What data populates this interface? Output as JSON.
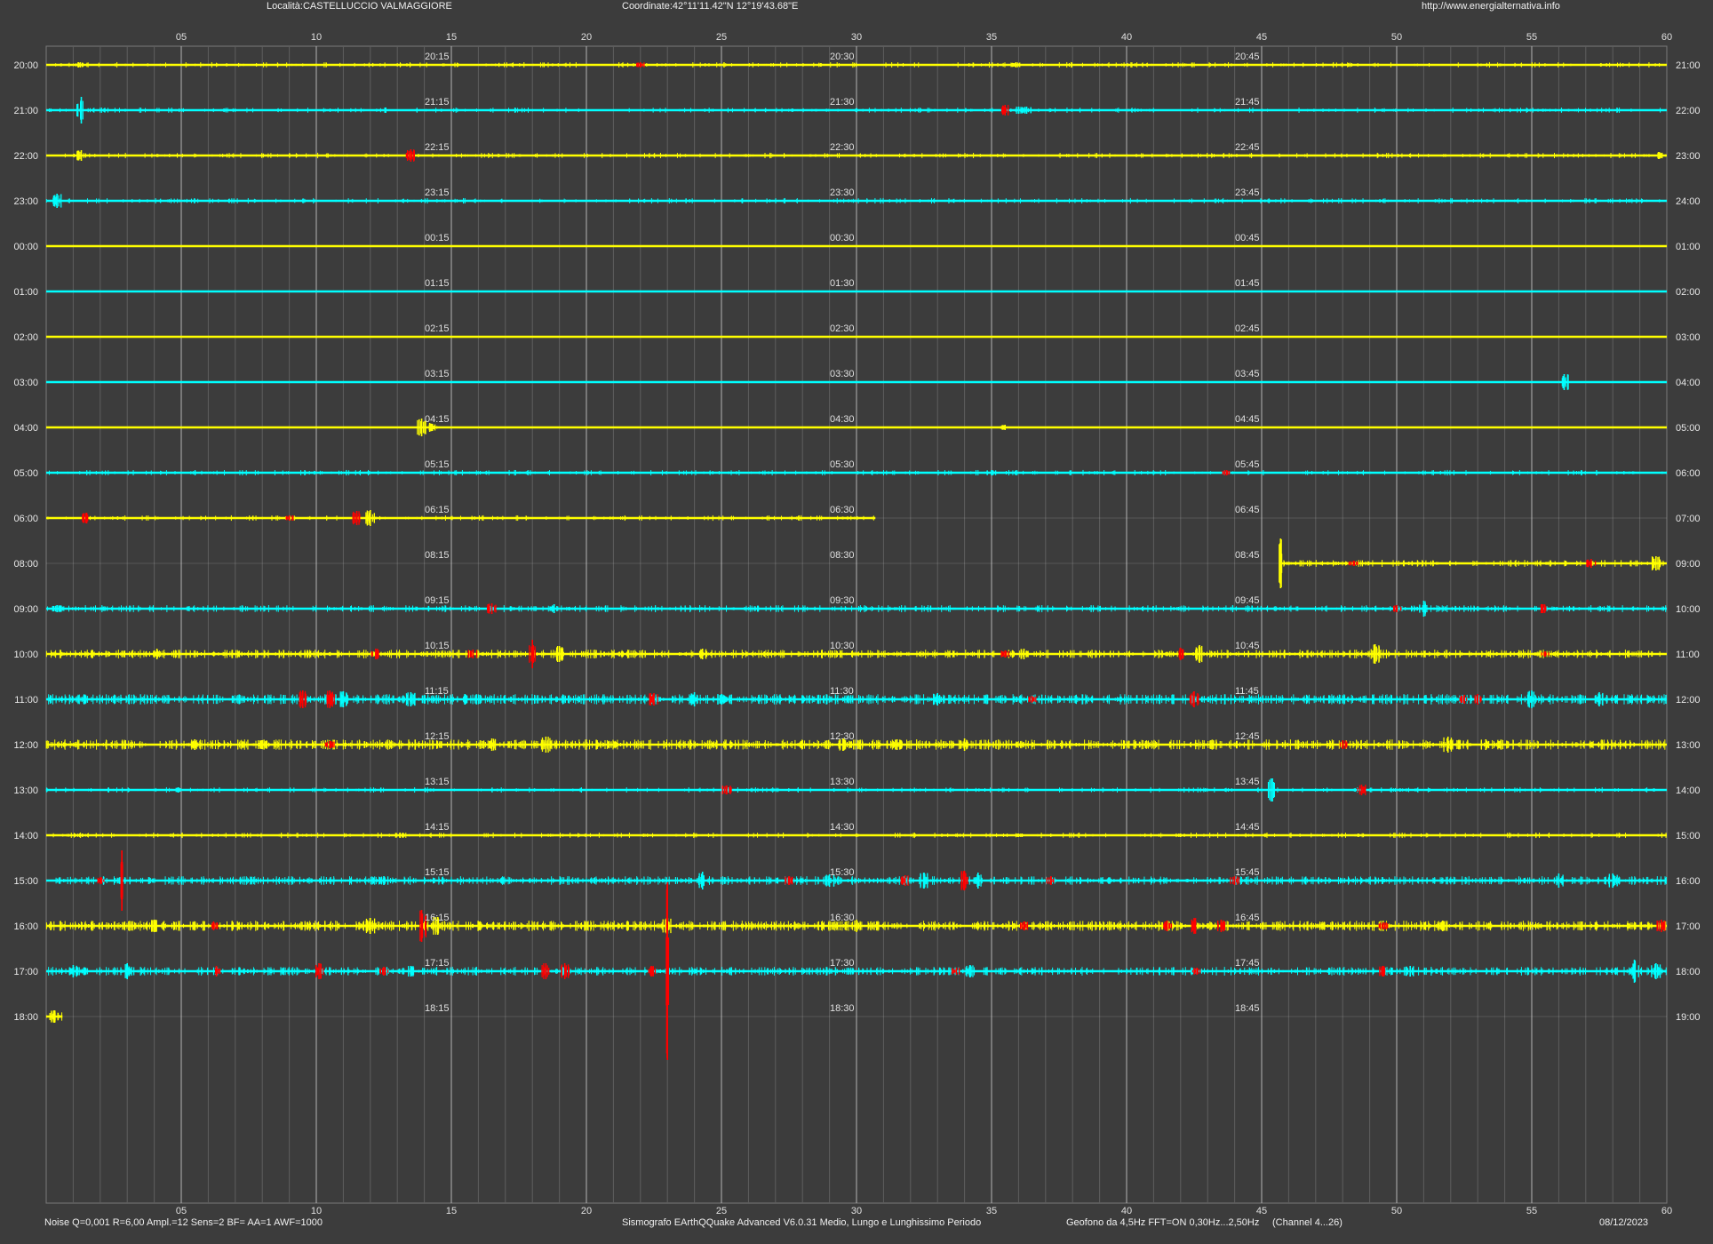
{
  "header": {
    "location": "Località:CASTELLUCCIO VALMAGGIORE",
    "coordinates": "Coordinate:42°11'11.42\"N  12°19'43.68\"E",
    "website": "http://www.energialternativa.info"
  },
  "footer": {
    "noise_params": "Noise Q=0,001 R=6,00 Ampl.=12 Sens=2 BF= AA=1 AWF=1000",
    "software": "Sismografo  EArthQQuake Advanced V6.0.31  Medio, Lungo e Lunghissimo Periodo",
    "geofono": "Geofono da 4,5Hz FFT=ON 0,30Hz...2,50Hz",
    "channel": "(Channel 4...26)",
    "date": "08/12/2023"
  },
  "colors": {
    "background": "#3c3c3c",
    "grid": "#7a7a7a",
    "trace_yellow": "#ffff00",
    "trace_cyan": "#00ffff",
    "event_red": "#ff0000"
  },
  "chart_data": {
    "type": "line",
    "xlabel": "",
    "ylabel": "",
    "xlim": [
      0,
      60
    ],
    "x_ticks": [
      "05",
      "10",
      "15",
      "20",
      "25",
      "30",
      "35",
      "40",
      "45",
      "50",
      "55",
      "60"
    ],
    "slot_labels_offsets": [
      "15",
      "30",
      "45"
    ],
    "rows": [
      {
        "left": "20:00",
        "right": "21:00",
        "slots": [
          "20:15",
          "20:30",
          "20:45"
        ],
        "color": "yellow",
        "end": 60,
        "activity": 1,
        "spikes": [
          {
            "x": 1.2,
            "amp": 3
          },
          {
            "x": 22.0,
            "amp": 3,
            "red": true
          },
          {
            "x": 35.9,
            "amp": 3
          }
        ]
      },
      {
        "left": "21:00",
        "right": "22:00",
        "slots": [
          "21:15",
          "21:30",
          "21:45"
        ],
        "color": "cyan",
        "end": 60,
        "activity": 1,
        "spikes": [
          {
            "x": 1.3,
            "amp": 15
          },
          {
            "x": 35.5,
            "amp": 6,
            "red": true
          },
          {
            "x": 36.0,
            "amp": 4
          },
          {
            "x": 36.3,
            "amp": 4
          }
        ]
      },
      {
        "left": "22:00",
        "right": "23:00",
        "slots": [
          "22:15",
          "22:30",
          "22:45"
        ],
        "color": "yellow",
        "end": 60,
        "activity": 1,
        "spikes": [
          {
            "x": 1.3,
            "amp": 6
          },
          {
            "x": 13.5,
            "amp": 7,
            "red": true
          },
          {
            "x": 59.7,
            "amp": 4
          }
        ]
      },
      {
        "left": "23:00",
        "right": "24:00",
        "slots": [
          "23:15",
          "23:30",
          "23:45"
        ],
        "color": "cyan",
        "end": 60,
        "activity": 1,
        "spikes": [
          {
            "x": 0.4,
            "amp": 8
          }
        ]
      },
      {
        "left": "00:00",
        "right": "01:00",
        "slots": [
          "00:15",
          "00:30",
          "00:45"
        ],
        "color": "yellow",
        "end": 60,
        "activity": 0,
        "spikes": []
      },
      {
        "left": "01:00",
        "right": "02:00",
        "slots": [
          "01:15",
          "01:30",
          "01:45"
        ],
        "color": "cyan",
        "end": 60,
        "activity": 0,
        "spikes": []
      },
      {
        "left": "02:00",
        "right": "03:00",
        "slots": [
          "02:15",
          "02:30",
          "02:45"
        ],
        "color": "yellow",
        "end": 60,
        "activity": 0,
        "spikes": []
      },
      {
        "left": "03:00",
        "right": "04:00",
        "slots": [
          "03:15",
          "03:30",
          "03:45"
        ],
        "color": "cyan",
        "end": 60,
        "activity": 0,
        "spikes": [
          {
            "x": 56.2,
            "amp": 9
          }
        ]
      },
      {
        "left": "04:00",
        "right": "05:00",
        "slots": [
          "04:15",
          "04:30",
          "04:45"
        ],
        "color": "yellow",
        "end": 60,
        "activity": 0,
        "spikes": [
          {
            "x": 13.9,
            "amp": 10
          },
          {
            "x": 14.2,
            "amp": 5
          },
          {
            "x": 14.3,
            "amp": 4
          },
          {
            "x": 35.5,
            "amp": 3
          }
        ]
      },
      {
        "left": "05:00",
        "right": "06:00",
        "slots": [
          "05:15",
          "05:30",
          "05:45"
        ],
        "color": "cyan",
        "end": 60,
        "activity": 1,
        "spikes": [
          {
            "x": 35.0,
            "amp": 3
          },
          {
            "x": 43.7,
            "amp": 3,
            "red": true
          }
        ]
      },
      {
        "left": "06:00",
        "right": "07:00",
        "slots": [
          "06:15",
          "06:30",
          "06:45"
        ],
        "color": "yellow",
        "end": 30.7,
        "activity": 1,
        "spikes": [
          {
            "x": 1.5,
            "amp": 6,
            "red": true
          },
          {
            "x": 9.0,
            "amp": 3,
            "red": true
          },
          {
            "x": 11.5,
            "amp": 8,
            "red": true
          },
          {
            "x": 12.0,
            "amp": 9
          }
        ]
      },
      {
        "left": "08:00",
        "right": "09:00",
        "slots": [
          "08:15",
          "08:30",
          "08:45"
        ],
        "color": "yellow",
        "start": 45.7,
        "end": 60,
        "activity": 2,
        "spikes": [
          {
            "x": 45.7,
            "amp": 28
          },
          {
            "x": 48.4,
            "amp": 3,
            "red": true
          },
          {
            "x": 57.2,
            "amp": 5,
            "red": true
          },
          {
            "x": 59.6,
            "amp": 8
          }
        ]
      },
      {
        "left": "09:00",
        "right": "10:00",
        "slots": [
          "09:15",
          "09:30",
          "09:45"
        ],
        "color": "cyan",
        "end": 60,
        "activity": 2,
        "spikes": [
          {
            "x": 0.4,
            "amp": 4
          },
          {
            "x": 16.5,
            "amp": 6,
            "red": true
          },
          {
            "x": 18.8,
            "amp": 5
          },
          {
            "x": 50.0,
            "amp": 4,
            "red": true
          },
          {
            "x": 51.0,
            "amp": 9
          },
          {
            "x": 55.4,
            "amp": 5,
            "red": true
          }
        ]
      },
      {
        "left": "10:00",
        "right": "11:00",
        "slots": [
          "10:15",
          "10:30",
          "10:45"
        ],
        "color": "yellow",
        "end": 60,
        "activity": 3,
        "spikes": [
          {
            "x": 4.1,
            "amp": 6
          },
          {
            "x": 12.2,
            "amp": 6,
            "red": true
          },
          {
            "x": 15.8,
            "amp": 5,
            "red": true
          },
          {
            "x": 18.0,
            "amp": 16,
            "red": true
          },
          {
            "x": 19.0,
            "amp": 9
          },
          {
            "x": 24.3,
            "amp": 6
          },
          {
            "x": 35.5,
            "amp": 4,
            "red": true
          },
          {
            "x": 36.2,
            "amp": 6
          },
          {
            "x": 42.0,
            "amp": 7,
            "red": true
          },
          {
            "x": 42.7,
            "amp": 10
          },
          {
            "x": 49.2,
            "amp": 11
          },
          {
            "x": 55.5,
            "amp": 3,
            "red": true
          }
        ]
      },
      {
        "left": "11:00",
        "right": "12:00",
        "slots": [
          "11:15",
          "11:30",
          "11:45"
        ],
        "color": "cyan",
        "end": 60,
        "activity": 4,
        "spikes": [
          {
            "x": 9.5,
            "amp": 10,
            "red": true
          },
          {
            "x": 10.5,
            "amp": 10,
            "red": true
          },
          {
            "x": 11.0,
            "amp": 9
          },
          {
            "x": 13.5,
            "amp": 8
          },
          {
            "x": 15.5,
            "amp": 6
          },
          {
            "x": 22.5,
            "amp": 7,
            "red": true
          },
          {
            "x": 24.0,
            "amp": 8
          },
          {
            "x": 25.0,
            "amp": 6
          },
          {
            "x": 33.0,
            "amp": 7
          },
          {
            "x": 36.5,
            "amp": 4,
            "red": true
          },
          {
            "x": 42.5,
            "amp": 9,
            "red": true
          },
          {
            "x": 52.5,
            "amp": 5,
            "red": true
          },
          {
            "x": 53.0,
            "amp": 6,
            "red": true
          },
          {
            "x": 55.0,
            "amp": 10
          },
          {
            "x": 57.5,
            "amp": 8
          }
        ]
      },
      {
        "left": "12:00",
        "right": "13:00",
        "slots": [
          "12:15",
          "12:30",
          "12:45"
        ],
        "color": "yellow",
        "end": 60,
        "activity": 4,
        "spikes": [
          {
            "x": 5.5,
            "amp": 6
          },
          {
            "x": 8.0,
            "amp": 5
          },
          {
            "x": 10.5,
            "amp": 4,
            "red": true
          },
          {
            "x": 16.5,
            "amp": 7
          },
          {
            "x": 18.5,
            "amp": 9
          },
          {
            "x": 29.5,
            "amp": 7
          },
          {
            "x": 31.5,
            "amp": 6
          },
          {
            "x": 34.0,
            "amp": 7
          },
          {
            "x": 48.0,
            "amp": 5,
            "red": true
          },
          {
            "x": 51.9,
            "amp": 9
          },
          {
            "x": 53.3,
            "amp": 6
          }
        ]
      },
      {
        "left": "13:00",
        "right": "14:00",
        "slots": [
          "13:15",
          "13:30",
          "13:45"
        ],
        "color": "cyan",
        "end": 60,
        "activity": 1,
        "spikes": [
          {
            "x": 4.9,
            "amp": 3
          },
          {
            "x": 25.2,
            "amp": 5,
            "red": true
          },
          {
            "x": 45.4,
            "amp": 13
          },
          {
            "x": 48.7,
            "amp": 6,
            "red": true
          }
        ]
      },
      {
        "left": "14:00",
        "right": "15:00",
        "slots": [
          "14:15",
          "14:30",
          "14:45"
        ],
        "color": "yellow",
        "end": 60,
        "activity": 1,
        "spikes": [
          {
            "x": 13.1,
            "amp": 3
          },
          {
            "x": 36.0,
            "amp": 2
          },
          {
            "x": 42.0,
            "amp": 2
          }
        ]
      },
      {
        "left": "15:00",
        "right": "16:00",
        "slots": [
          "15:15",
          "15:30",
          "15:45"
        ],
        "color": "cyan",
        "end": 60,
        "activity": 3,
        "spikes": [
          {
            "x": 2.0,
            "amp": 4,
            "red": true
          },
          {
            "x": 2.8,
            "amp": 34,
            "red": true
          },
          {
            "x": 12.5,
            "amp": 5
          },
          {
            "x": 24.3,
            "amp": 10
          },
          {
            "x": 27.5,
            "amp": 5,
            "red": true
          },
          {
            "x": 29.0,
            "amp": 7
          },
          {
            "x": 31.8,
            "amp": 6,
            "red": true
          },
          {
            "x": 32.5,
            "amp": 9
          },
          {
            "x": 34.0,
            "amp": 11,
            "red": true
          },
          {
            "x": 34.5,
            "amp": 9
          },
          {
            "x": 37.2,
            "amp": 5,
            "red": true
          },
          {
            "x": 44.0,
            "amp": 5,
            "red": true
          },
          {
            "x": 56.0,
            "amp": 8
          },
          {
            "x": 58.0,
            "amp": 8
          }
        ]
      },
      {
        "left": "16:00",
        "right": "17:00",
        "slots": [
          "16:15",
          "16:30",
          "16:45"
        ],
        "color": "yellow",
        "end": 60,
        "activity": 4,
        "spikes": [
          {
            "x": 4.0,
            "amp": 7
          },
          {
            "x": 6.2,
            "amp": 5,
            "red": true
          },
          {
            "x": 12.0,
            "amp": 9
          },
          {
            "x": 13.9,
            "amp": 18,
            "red": true
          },
          {
            "x": 14.5,
            "amp": 10
          },
          {
            "x": 23.0,
            "amp": 9
          },
          {
            "x": 30.0,
            "amp": 7
          },
          {
            "x": 36.2,
            "amp": 5,
            "red": true
          },
          {
            "x": 41.5,
            "amp": 6,
            "red": true
          },
          {
            "x": 42.5,
            "amp": 9,
            "red": true
          },
          {
            "x": 43.5,
            "amp": 7,
            "red": true
          },
          {
            "x": 49.5,
            "amp": 4,
            "red": true
          },
          {
            "x": 51.7,
            "amp": 6
          },
          {
            "x": 59.8,
            "amp": 7,
            "red": true
          }
        ]
      },
      {
        "left": "17:00",
        "right": "18:00",
        "slots": [
          "17:15",
          "17:30",
          "17:45"
        ],
        "color": "cyan",
        "end": 60,
        "activity": 3,
        "spikes": [
          {
            "x": 1.0,
            "amp": 7
          },
          {
            "x": 3.0,
            "amp": 9
          },
          {
            "x": 6.3,
            "amp": 6,
            "red": true
          },
          {
            "x": 10.1,
            "amp": 9,
            "red": true
          },
          {
            "x": 12.5,
            "amp": 5,
            "red": true
          },
          {
            "x": 13.5,
            "amp": 6
          },
          {
            "x": 18.5,
            "amp": 9,
            "red": true
          },
          {
            "x": 19.2,
            "amp": 9,
            "red": true
          },
          {
            "x": 22.4,
            "amp": 6,
            "red": true
          },
          {
            "x": 23.0,
            "amp": 100,
            "red": true
          },
          {
            "x": 33.7,
            "amp": 4,
            "red": true
          },
          {
            "x": 34.2,
            "amp": 7
          },
          {
            "x": 42.6,
            "amp": 4,
            "red": true
          },
          {
            "x": 49.5,
            "amp": 6,
            "red": true
          },
          {
            "x": 50.5,
            "amp": 6
          },
          {
            "x": 58.8,
            "amp": 13
          },
          {
            "x": 59.6,
            "amp": 9
          }
        ]
      },
      {
        "left": "18:00",
        "right": "19:00",
        "slots": [
          "18:15",
          "18:30",
          "18:45"
        ],
        "color": "yellow",
        "start": 0,
        "end": 0.6,
        "activity": 3,
        "spikes": [
          {
            "x": 0.3,
            "amp": 7
          }
        ]
      }
    ]
  }
}
